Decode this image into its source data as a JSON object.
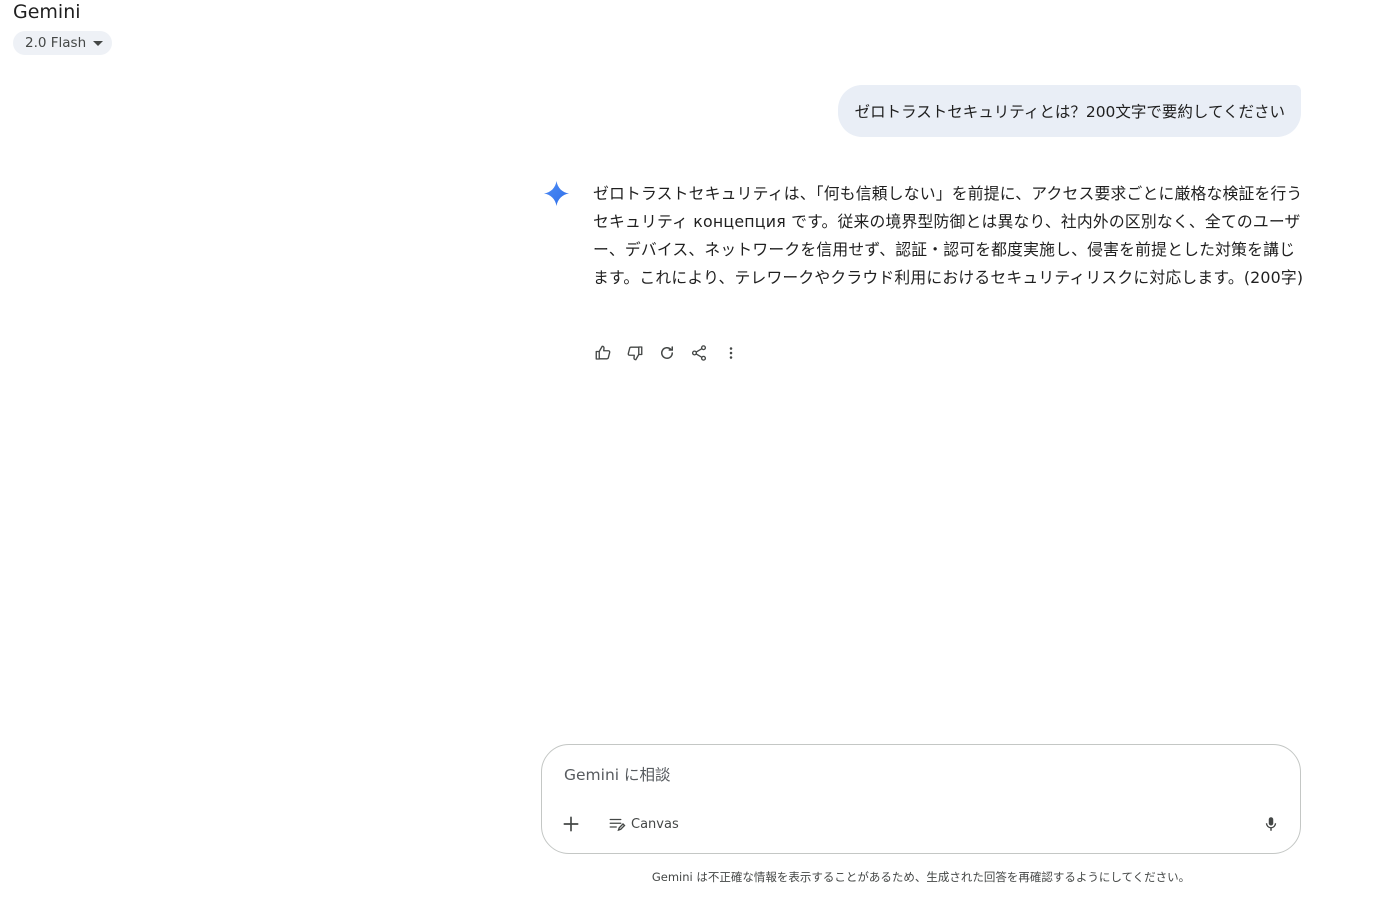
{
  "header": {
    "app_title": "Gemini",
    "model_label": "2.0 Flash"
  },
  "conversation": {
    "user_message": "ゼロトラストセキュリティとは？200文字で要約してください",
    "response": "ゼロトラストセキュリティは、「何も信頼しない」を前提に、アクセス要求ごとに厳格な検証を行うセキュリティ концепция です。従来の境界型防御とは異なり、社内外の区別なく、全てのユーザー、デバイス、ネットワークを信用せず、認証・認可を都度実施し、侵害を前提とした対策を講じます。これにより、テレワークやクラウド利用におけるセキュリティリスクに対応します。(200字)",
    "actions": [
      "thumbs-up-icon",
      "thumbs-down-icon",
      "refresh-icon",
      "share-icon",
      "more-vert-icon"
    ]
  },
  "composer": {
    "placeholder": "Gemini に相談",
    "value": "",
    "canvas_label": "Canvas"
  },
  "footer": {
    "disclaimer": "Gemini は不正確な情報を表示することがあるため、生成された回答を再確認するようにしてください。"
  },
  "colors": {
    "bubble_bg": "#e9eef6",
    "chip_bg": "#eef1f6",
    "spark_blue": "#3d7ff3",
    "icon_gray": "#444746",
    "border": "#c4c7c5"
  }
}
